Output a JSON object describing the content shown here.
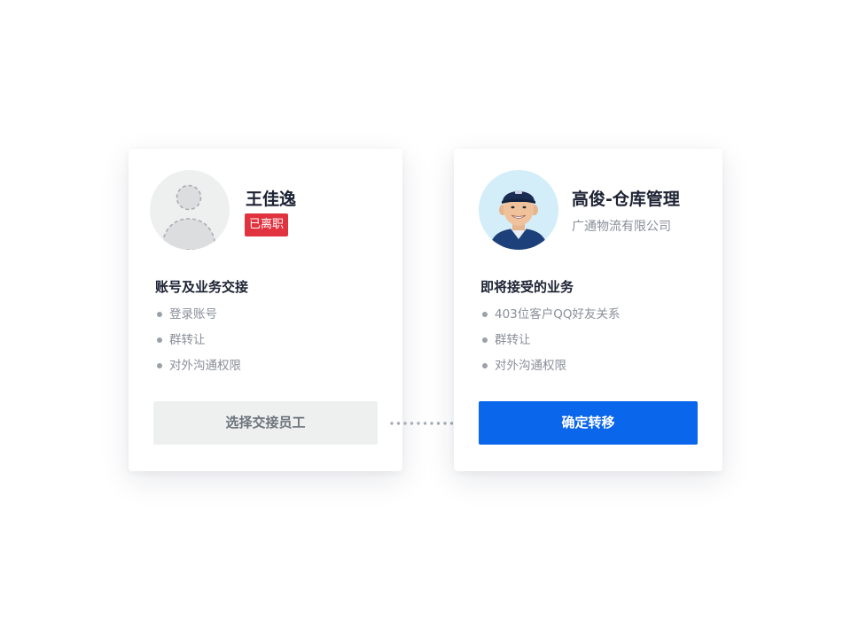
{
  "from_user": {
    "name": "王佳逸",
    "status_badge": "已离职",
    "section_title": "账号及业务交接",
    "items": [
      "登录账号",
      "群转让",
      "对外沟通权限"
    ],
    "action_label": "选择交接员工"
  },
  "to_user": {
    "name": "高俊-仓库管理",
    "company": "广通物流有限公司",
    "section_title": "即将接受的业务",
    "items": [
      "403位客户QQ好友关系",
      "群转让",
      "对外沟通权限"
    ],
    "action_label": "确定转移"
  },
  "colors": {
    "primary": "#0a66ea",
    "danger_badge": "#e0333f",
    "secondary_button": "#eef0f0",
    "text_dark": "#1c2233",
    "text_muted": "#8a8f99"
  },
  "icons": {
    "placeholder_avatar": "user-placeholder-icon",
    "connector": "dotted-connector"
  }
}
